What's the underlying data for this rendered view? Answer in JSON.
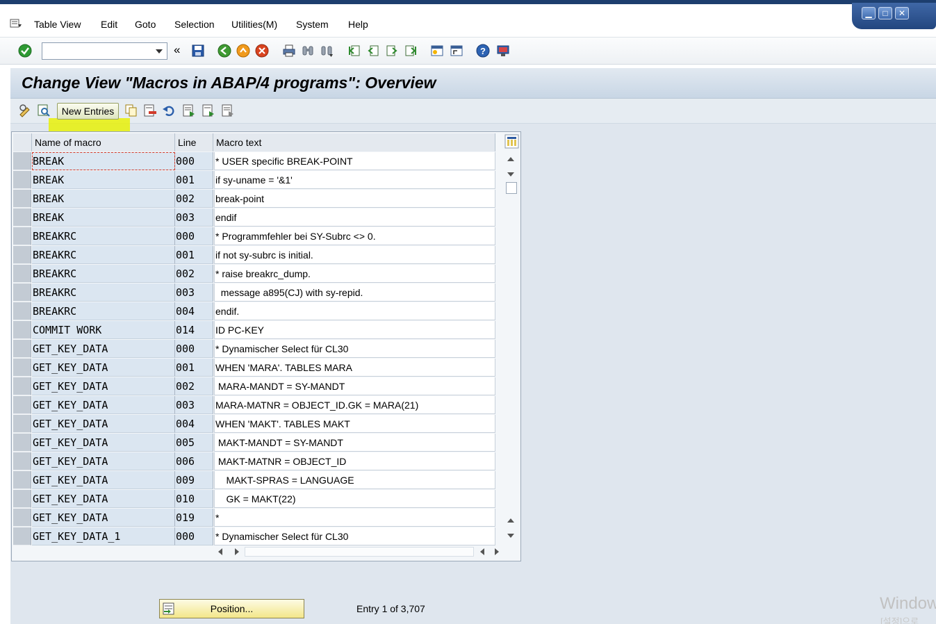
{
  "menu": {
    "items": [
      "Table View",
      "Edit",
      "Goto",
      "Selection",
      "Utilities(M)",
      "System",
      "Help"
    ]
  },
  "toolbar": {
    "command_value": "",
    "icons": [
      "enter-icon",
      "back-icon",
      "save-icon",
      "back-green-icon",
      "exit-icon",
      "cancel-icon",
      "print-icon",
      "find-icon",
      "find-next-icon",
      "first-page-icon",
      "prev-page-icon",
      "next-page-icon",
      "last-page-icon",
      "create-session-icon",
      "shortcut-icon",
      "help-icon",
      "customize-layout-icon"
    ]
  },
  "page": {
    "title": "Change View \"Macros in ABAP/4 programs\": Overview",
    "new_entries": "New Entries"
  },
  "table": {
    "headers": [
      "Name of macro",
      "Line",
      "Macro text"
    ],
    "rows": [
      {
        "name": "BREAK",
        "line": "000",
        "text": "* USER specific BREAK-POINT"
      },
      {
        "name": "BREAK",
        "line": "001",
        "text": "if sy-uname = '&1'"
      },
      {
        "name": "BREAK",
        "line": "002",
        "text": "break-point"
      },
      {
        "name": "BREAK",
        "line": "003",
        "text": "endif"
      },
      {
        "name": "BREAKRC",
        "line": "000",
        "text": "* Programmfehler bei SY-Subrc <> 0."
      },
      {
        "name": "BREAKRC",
        "line": "001",
        "text": "if not sy-subrc is initial."
      },
      {
        "name": "BREAKRC",
        "line": "002",
        "text": "* raise breakrc_dump."
      },
      {
        "name": "BREAKRC",
        "line": "003",
        "text": "  message a895(CJ) with sy-repid."
      },
      {
        "name": "BREAKRC",
        "line": "004",
        "text": "endif."
      },
      {
        "name": "COMMIT WORK",
        "line": "014",
        "text": "ID PC-KEY"
      },
      {
        "name": "GET_KEY_DATA",
        "line": "000",
        "text": "* Dynamischer Select für CL30"
      },
      {
        "name": "GET_KEY_DATA",
        "line": "001",
        "text": "WHEN 'MARA'. TABLES MARA"
      },
      {
        "name": "GET_KEY_DATA",
        "line": "002",
        "text": " MARA-MANDT = SY-MANDT"
      },
      {
        "name": "GET_KEY_DATA",
        "line": "003",
        "text": "MARA-MATNR = OBJECT_ID.GK = MARA(21)"
      },
      {
        "name": "GET_KEY_DATA",
        "line": "004",
        "text": "WHEN 'MAKT'. TABLES MAKT"
      },
      {
        "name": "GET_KEY_DATA",
        "line": "005",
        "text": " MAKT-MANDT = SY-MANDT"
      },
      {
        "name": "GET_KEY_DATA",
        "line": "006",
        "text": " MAKT-MATNR = OBJECT_ID"
      },
      {
        "name": "GET_KEY_DATA",
        "line": "009",
        "text": "    MAKT-SPRAS = LANGUAGE"
      },
      {
        "name": "GET_KEY_DATA",
        "line": "010",
        "text": "    GK = MAKT(22)"
      },
      {
        "name": "GET_KEY_DATA",
        "line": "019",
        "text": "*"
      },
      {
        "name": "GET_KEY_DATA_1",
        "line": "000",
        "text": "* Dynamischer Select für CL30"
      }
    ]
  },
  "footer": {
    "position_button": "Position...",
    "entry_info": "Entry 1 of 3,707"
  },
  "watermark": {
    "line1": "Windows",
    "line2": "[설정]으로"
  }
}
